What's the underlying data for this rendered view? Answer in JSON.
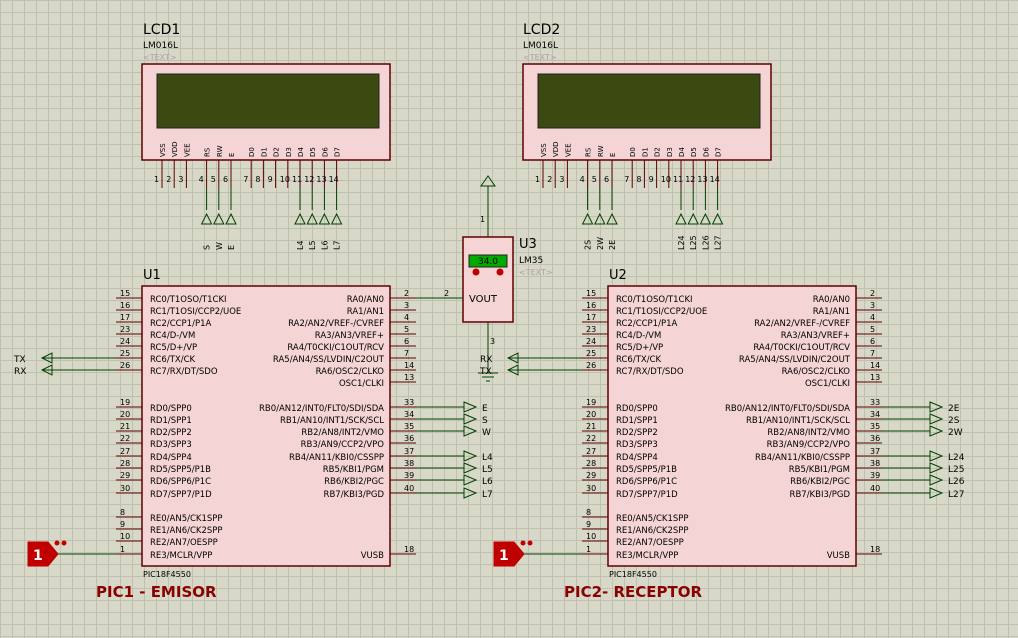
{
  "colors": {
    "wire": "#004000",
    "body": "#f4d4d4",
    "outline": "#600000",
    "lcd": "#3a4a10",
    "text": "#000000",
    "title": "#8b0000",
    "pin": "#600000",
    "probe": "#c00000",
    "meter": "#00aa00",
    "hint": "#b0a0a0"
  },
  "lcd1": {
    "name": "LCD1",
    "model": "LM016L",
    "hint": "<TEXT>",
    "pin_labels": [
      "VSS",
      "VDD",
      "VEE",
      "RS",
      "RW",
      "E",
      "D0",
      "D1",
      "D2",
      "D3",
      "D4",
      "D5",
      "D6",
      "D7"
    ],
    "pin_nums": [
      "1",
      "2",
      "3",
      "4",
      "5",
      "6",
      "7",
      "8",
      "9",
      "10",
      "11",
      "12",
      "13",
      "14"
    ],
    "net_ctrl": [
      "S",
      "W",
      "E"
    ],
    "net_data": [
      "L4",
      "L5",
      "L6",
      "L7"
    ]
  },
  "lcd2": {
    "name": "LCD2",
    "model": "LM016L",
    "hint": "<TEXT>",
    "pin_labels": [
      "VSS",
      "VDD",
      "VEE",
      "RS",
      "RW",
      "E",
      "D0",
      "D1",
      "D2",
      "D3",
      "D4",
      "D5",
      "D6",
      "D7"
    ],
    "pin_nums": [
      "1",
      "2",
      "3",
      "4",
      "5",
      "6",
      "7",
      "8",
      "9",
      "10",
      "11",
      "12",
      "13",
      "14"
    ],
    "net_ctrl": [
      "2S",
      "2W",
      "2E"
    ],
    "net_data": [
      "L24",
      "L25",
      "L26",
      "L27"
    ]
  },
  "u3": {
    "name": "U3",
    "model": "LM35",
    "hint": "<TEXT>",
    "reading": "34.0",
    "pin_label": "VOUT",
    "pin_top": "1",
    "pin_out": "2",
    "pin_gnd": "3"
  },
  "u1": {
    "name": "U1",
    "model": "PIC18F4550",
    "caption": "PIC1 - EMISOR",
    "nets_left": [
      "TX",
      "RX"
    ],
    "nets_right": [
      "E",
      "S",
      "W",
      "L4",
      "L5",
      "L6",
      "L7"
    ],
    "probe": "1"
  },
  "u2": {
    "name": "U2",
    "model": "PIC18F4550",
    "caption": "PIC2- RECEPTOR",
    "nets_left": [
      "RX",
      "TX"
    ],
    "nets_right": [
      "2E",
      "2S",
      "2W",
      "L24",
      "L25",
      "L26",
      "L27"
    ],
    "probe": "1"
  },
  "pic": {
    "left": [
      {
        "n": "15",
        "l": "RC0/T1OSO/T1CKI"
      },
      {
        "n": "16",
        "l": "RC1/T1OSI/CCP2/UOE"
      },
      {
        "n": "17",
        "l": "RC2/CCP1/P1A"
      },
      {
        "n": "23",
        "l": "RC4/D-/VM"
      },
      {
        "n": "24",
        "l": "RC5/D+/VP"
      },
      {
        "n": "25",
        "l": "RC6/TX/CK"
      },
      {
        "n": "26",
        "l": "RC7/RX/DT/SDO"
      },
      {
        "n": "19",
        "l": "RD0/SPP0"
      },
      {
        "n": "20",
        "l": "RD1/SPP1"
      },
      {
        "n": "21",
        "l": "RD2/SPP2"
      },
      {
        "n": "22",
        "l": "RD3/SPP3"
      },
      {
        "n": "27",
        "l": "RD4/SPP4"
      },
      {
        "n": "28",
        "l": "RD5/SPP5/P1B"
      },
      {
        "n": "29",
        "l": "RD6/SPP6/P1C"
      },
      {
        "n": "30",
        "l": "RD7/SPP7/P1D"
      },
      {
        "n": "8",
        "l": "RE0/AN5/CK1SPP"
      },
      {
        "n": "9",
        "l": "RE1/AN6/CK2SPP"
      },
      {
        "n": "10",
        "l": "RE2/AN7/OESPP"
      },
      {
        "n": "1",
        "l": "RE3/MCLR/VPP"
      }
    ],
    "right": [
      {
        "n": "2",
        "l": "RA0/AN0"
      },
      {
        "n": "3",
        "l": "RA1/AN1"
      },
      {
        "n": "4",
        "l": "RA2/AN2/VREF-/CVREF"
      },
      {
        "n": "5",
        "l": "RA3/AN3/VREF+"
      },
      {
        "n": "6",
        "l": "RA4/T0CKI/C1OUT/RCV"
      },
      {
        "n": "7",
        "l": "RA5/AN4/SS/LVDIN/C2OUT"
      },
      {
        "n": "14",
        "l": "RA6/OSC2/CLKO"
      },
      {
        "n": "13",
        "l": "OSC1/CLKI"
      },
      {
        "n": "33",
        "l": "RB0/AN12/INT0/FLT0/SDI/SDA"
      },
      {
        "n": "34",
        "l": "RB1/AN10/INT1/SCK/SCL"
      },
      {
        "n": "35",
        "l": "RB2/AN8/INT2/VMO"
      },
      {
        "n": "36",
        "l": "RB3/AN9/CCP2/VPO"
      },
      {
        "n": "37",
        "l": "RB4/AN11/KBI0/CSSPP"
      },
      {
        "n": "38",
        "l": "RB5/KBI1/PGM"
      },
      {
        "n": "39",
        "l": "RB6/KBI2/PGC"
      },
      {
        "n": "40",
        "l": "RB7/KBI3/PGD"
      },
      {
        "n": "18",
        "l": "VUSB"
      }
    ]
  }
}
